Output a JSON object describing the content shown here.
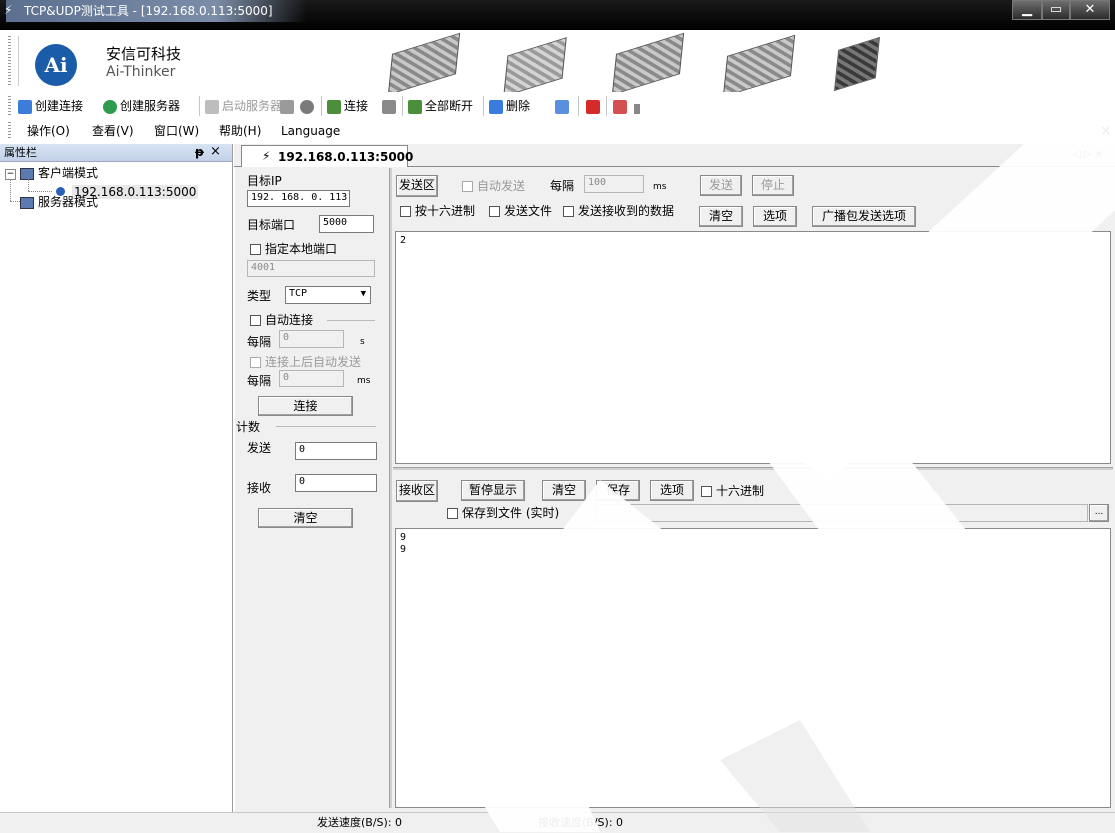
{
  "window": {
    "title": "TCP&UDP测试工具 - [192.168.0.113:5000]",
    "title_icon": "network-plug-icon",
    "controls": [
      "minimize-icon",
      "maximize-icon",
      "close-icon"
    ]
  },
  "logo": {
    "mark": "Ai",
    "name_cn": "安信可科技",
    "name_en": "Ai-Thinker"
  },
  "toolbar": {
    "create_connection": "创建连接",
    "create_server": "创建服务器",
    "start_server": "启动服务器",
    "connect": "连接",
    "disconnect_all": "全部断开",
    "delete": "删除"
  },
  "menu": {
    "operate": "操作(O)",
    "view": "查看(V)",
    "window": "窗口(W)",
    "help": "帮助(H)",
    "language": "Language",
    "close": "×"
  },
  "left_panel": {
    "header": "属性栏",
    "pin": "ᵖ",
    "close": "×",
    "tree": {
      "client_mode": "客户端模式",
      "client_conn": "192.168.0.113:5000",
      "server_mode": "服务器模式"
    }
  },
  "tab": {
    "label": "192.168.0.113:5000",
    "nav": "◁ ▷ ×"
  },
  "config": {
    "target_ip_label": "目标IP",
    "target_ip": "192. 168. 0. 113",
    "target_port_label": "目标端口",
    "target_port": "5000",
    "local_port_check": "指定本地端口",
    "local_port": "4001",
    "type_label": "类型",
    "type_value": "TCP",
    "auto_connect_check": "自动连接",
    "interval_label": "每隔",
    "interval1": "0",
    "unit_s": "s",
    "auto_send_after_connect": "连接上后自动发送",
    "interval2": "0",
    "unit_ms": "ms",
    "connect_button": "连接",
    "count_label": "计数",
    "send_label": "发送",
    "send_count": "0",
    "recv_label": "接收",
    "recv_count": "0",
    "clear_button": "清空"
  },
  "send_area": {
    "label": "发送区",
    "auto_send": "自动发送",
    "interval_label": "每隔",
    "interval_value": "100",
    "unit": "ms",
    "send_button": "发送",
    "stop_button": "停止",
    "hex_send": "按十六进制",
    "send_file": "发送文件",
    "send_received": "发送接收到的数据",
    "clear_button": "清空",
    "options_button": "选项",
    "broadcast_button": "广播包发送选项",
    "content": "2"
  },
  "recv_area": {
    "label": "接收区",
    "pause_button": "暂停显示",
    "clear_button": "清空",
    "save_button": "保存",
    "options_button": "选项",
    "hex_check": "十六进制",
    "save_to_file": "保存到文件 (实时)",
    "browse_button": "...",
    "content": "9\n9"
  },
  "status": {
    "send_speed": "发送速度(B/S): 0",
    "recv_speed": "接收速度(B/S): 0"
  },
  "watermark": "Ai-Thinker"
}
